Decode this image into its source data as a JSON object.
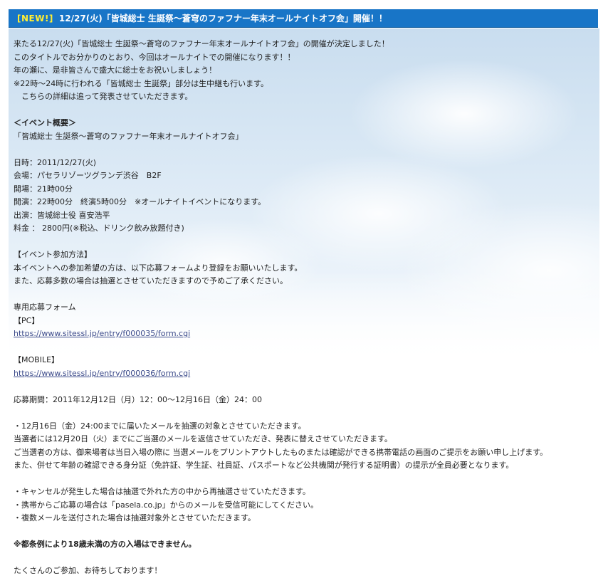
{
  "header": {
    "badge": "[NEW!]",
    "title": "12/27(火)「皆城総士 生誕祭～蒼穹のファフナー年末オールナイトオフ会」開催！！"
  },
  "intro": [
    "来たる12/27(火)「皆城総士 生誕祭～蒼穹のファフナー年末オールナイトオフ会」の開催が決定しました！",
    "このタイトルでお分かりのとおり、今回はオールナイトでの開催になります！！",
    "年の瀬に、是非皆さんで盛大に総士をお祝いしましょう！",
    "※22時～24時に行われる「皆城総士 生誕祭」部分は生中継も行います。",
    "　こちらの詳細は追って発表させていただきます。"
  ],
  "overview": {
    "heading": "＜イベント概要＞",
    "event_name": "「皆城総士 生誕祭～蒼穹のファフナー年末オールナイトオフ会」",
    "details": [
      "日時：2011/12/27(火)",
      "会場：パセラリゾーツグランデ渋谷　B2F",
      "開場：21時00分",
      "開演：22時00分　終演5時00分　※オールナイトイベントになります。",
      "出演：皆城総士役 喜安浩平",
      "料金 ： 2800円(※税込、ドリンク飲み放題付き)"
    ]
  },
  "participation": {
    "heading": "【イベント参加方法】",
    "lines": [
      "本イベントへの参加希望の方は、以下応募フォームより登録をお願いいたします。",
      "また、応募多数の場合は抽選とさせていただきますので予めご了承ください。"
    ],
    "form_label": "専用応募フォーム",
    "pc_label": "【PC】",
    "pc_link": "https://www.sitessl.jp/entry/f000035/form.cgi",
    "mobile_label": "【MOBILE】",
    "mobile_link": "https://www.sitessl.jp/entry/f000036/form.cgi",
    "period": "応募期間：2011年12月12日（月）12：00～12月16日（金）24：00"
  },
  "notes1": [
    "・12月16日（金）24:00までに届いたメールを抽選の対象とさせていただきます。",
    "当選者には12月20日（火）までにご当選のメールを返信させていただき、発表に替えさせていただきます。",
    "ご当選者の方は、御来場者は当日入場の際に 当選メールをプリントアウトしたものまたは確認ができる携帯電話の画面のご提示をお願い申し上げます。",
    "また、併せて年齢の確認できる身分証（免許証、学生証、社員証、パスポートなど公共機関が発行する証明書）の提示が全員必要となります。"
  ],
  "notes2": [
    "・キャンセルが発生した場合は抽選で外れた方の中から再抽選させていただきます。",
    "・携帯からご応募の場合は「pasela.co.jp」からのメールを受信可能にしてください。",
    "・複数メールを送付された場合は抽選対象外とさせていただきます。"
  ],
  "warning": "※都条例により18歳未満の方の入場はできません。",
  "closing": "たくさんのご参加、お待ちしております！"
}
